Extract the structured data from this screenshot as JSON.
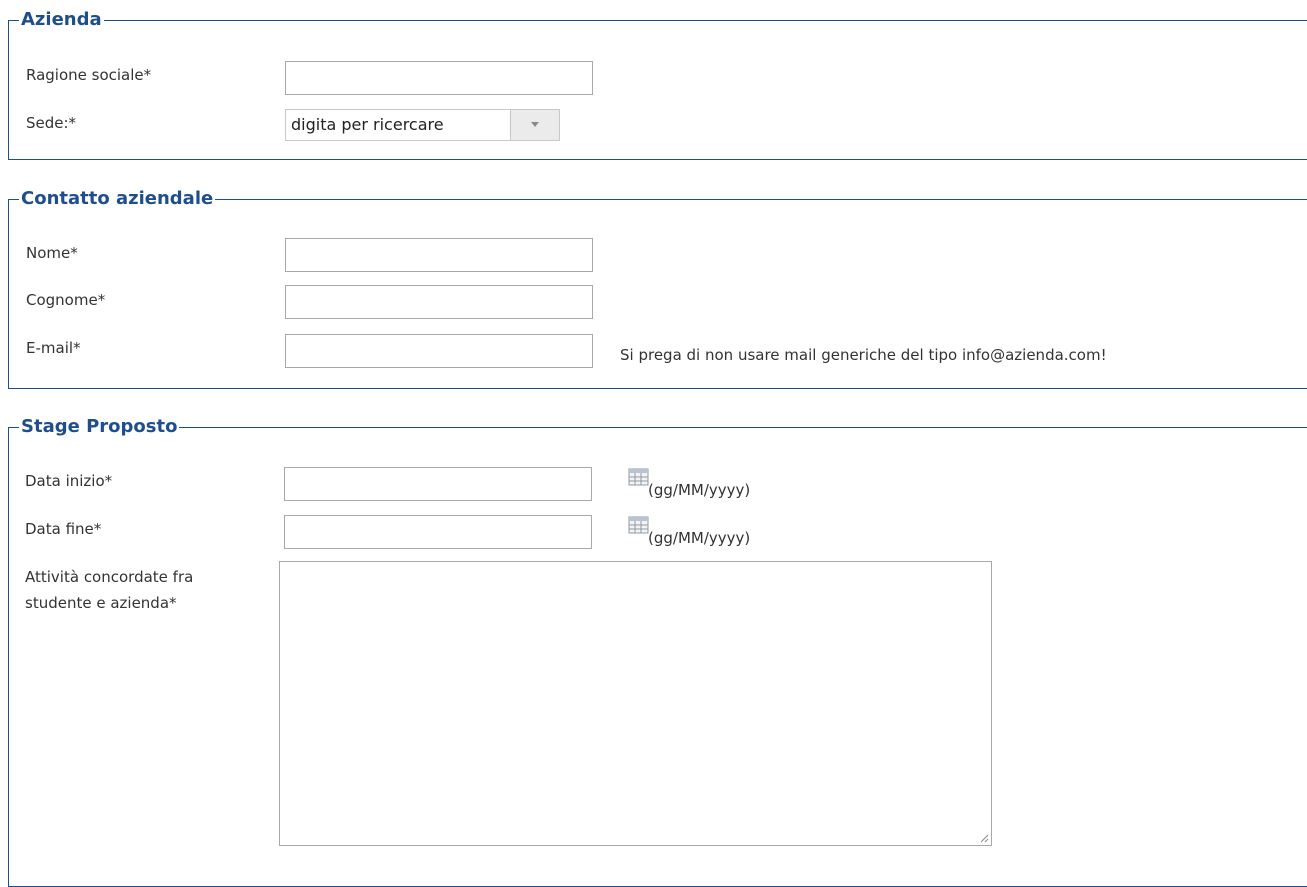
{
  "azienda": {
    "legend": "Azienda",
    "ragione_sociale_label": "Ragione sociale*",
    "ragione_sociale_value": "",
    "sede_label": "Sede:*",
    "sede_placeholder": "digita per ricercare"
  },
  "contatto": {
    "legend": "Contatto aziendale",
    "nome_label": "Nome*",
    "nome_value": "",
    "cognome_label": "Cognome*",
    "cognome_value": "",
    "email_label": "E-mail*",
    "email_value": "",
    "email_hint": "Si prega di non usare mail generiche del tipo info@azienda.com!"
  },
  "stage": {
    "legend": "Stage Proposto",
    "data_inizio_label": "Data inizio*",
    "data_inizio_value": "",
    "data_inizio_format": "(gg/MM/yyyy)",
    "data_fine_label": "Data fine*",
    "data_fine_value": "",
    "data_fine_format": "(gg/MM/yyyy)",
    "attivita_label_line1": "Attività concordate fra",
    "attivita_label_line2": "studente e azienda*",
    "attivita_value": ""
  },
  "icons": {
    "calendar": "calendar-icon",
    "dropdown": "chevron-down-icon",
    "resize": "resize-grip-icon"
  },
  "colors": {
    "legend": "#1f4e8c",
    "border": "#1f4e8c",
    "text": "#333333"
  }
}
